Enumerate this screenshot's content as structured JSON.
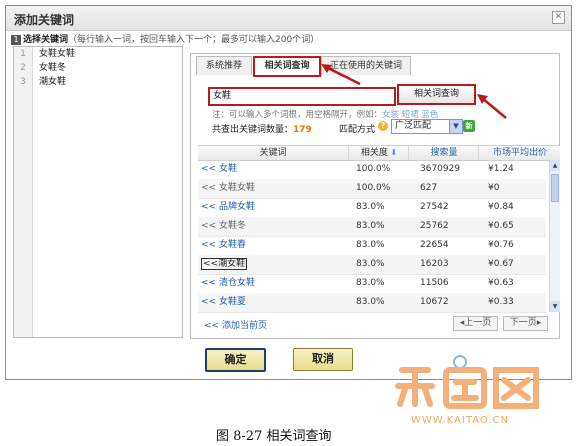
{
  "dialog": {
    "title": "添加关键词",
    "close_label": "✕"
  },
  "instruction": {
    "step_num": "1",
    "title": "选择关键词",
    "hint": "（每行输入一词，按回车输入下一个；最多可以输入200个词）"
  },
  "left_list": [
    {
      "num": "1",
      "text": "女鞋女鞋"
    },
    {
      "num": "2",
      "text": "女鞋冬"
    },
    {
      "num": "3",
      "text": "潮女鞋"
    }
  ],
  "tabs": [
    {
      "label": "系统推荐"
    },
    {
      "label": "相关词查询"
    },
    {
      "label": "正在使用的关键词"
    }
  ],
  "search": {
    "value": "女鞋",
    "button_label": "相关词查询"
  },
  "note": {
    "text": "注：可以输入多个词根，用空格隔开，例如：",
    "examples": "女装 短裙 蓝色"
  },
  "result_count": {
    "label": "共查出关键词数量：",
    "value": "179"
  },
  "match": {
    "label": "匹配方式",
    "help": "?",
    "selected": "广泛匹配",
    "new_badge": "新"
  },
  "table": {
    "headers": {
      "keyword": "关键词",
      "relevance": "相关度",
      "search_volume": "搜索量",
      "avg_price": "市场平均出价"
    },
    "rows": [
      {
        "prefix": "<<",
        "keyword": "女鞋",
        "relevance": "100.0%",
        "search_volume": "3670929",
        "avg_price": "¥1.24"
      },
      {
        "prefix": "<<",
        "keyword": "女鞋女鞋",
        "relevance": "100.0%",
        "search_volume": "627",
        "avg_price": "¥0"
      },
      {
        "prefix": "<<",
        "keyword": "品牌女鞋",
        "relevance": "83.0%",
        "search_volume": "27542",
        "avg_price": "¥0.84"
      },
      {
        "prefix": "<<",
        "keyword": "女鞋冬",
        "relevance": "83.0%",
        "search_volume": "25762",
        "avg_price": "¥0.65"
      },
      {
        "prefix": "<<",
        "keyword": "女鞋春",
        "relevance": "83.0%",
        "search_volume": "22654",
        "avg_price": "¥0.76"
      },
      {
        "prefix": "<<",
        "keyword": "潮女鞋",
        "relevance": "83.0%",
        "search_volume": "16203",
        "avg_price": "¥0.67"
      },
      {
        "prefix": "<<",
        "keyword": "清仓女鞋",
        "relevance": "83.0%",
        "search_volume": "11506",
        "avg_price": "¥0.63"
      },
      {
        "prefix": "<<",
        "keyword": "女鞋夏",
        "relevance": "83.0%",
        "search_volume": "10672",
        "avg_price": "¥0.33"
      }
    ]
  },
  "footer": {
    "add_current_page": "<< 添加当前页",
    "prev_page": "◂上一页",
    "next_page": "下一页▸"
  },
  "buttons": {
    "ok": "确定",
    "cancel": "取消"
  },
  "caption": "图 8-27    相关词查询",
  "watermark": {
    "url": "WWW.KAITAO.CN"
  },
  "colors": {
    "highlight_red": "#b71b1b",
    "link_blue": "#2a5fa8",
    "count_orange": "#d97a00",
    "watermark_orange": "#f4b07a"
  }
}
